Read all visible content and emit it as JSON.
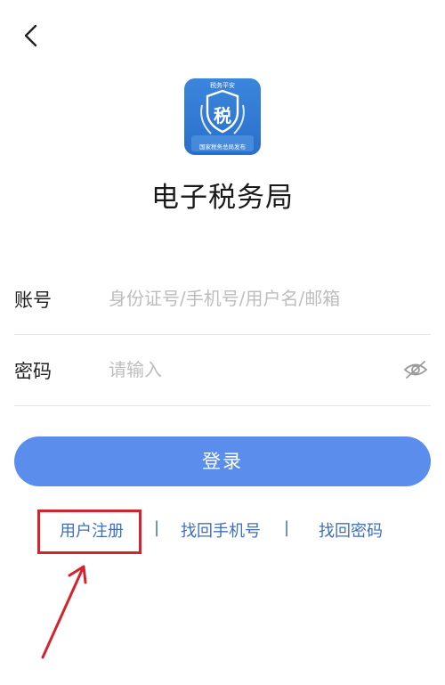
{
  "header": {
    "back_icon": "chevron-left-icon"
  },
  "logo": {
    "top_text": "税务平安",
    "center_char": "税",
    "bottom_text": "国家税务总局发布",
    "color": "#2f7bd8"
  },
  "app": {
    "title": "电子税务局"
  },
  "form": {
    "account": {
      "label": "账号",
      "placeholder": "身份证号/手机号/用户名/邮箱",
      "value": ""
    },
    "password": {
      "label": "密码",
      "placeholder": "请输入",
      "value": "",
      "toggle_icon": "eye-off-icon"
    }
  },
  "login_button": {
    "label": "登录",
    "color": "#5b8ded"
  },
  "links": {
    "register": "用户注册",
    "separator": "|",
    "recover_phone": "找回手机号",
    "recover_password": "找回密码"
  },
  "annotation": {
    "color": "#d4232d"
  }
}
